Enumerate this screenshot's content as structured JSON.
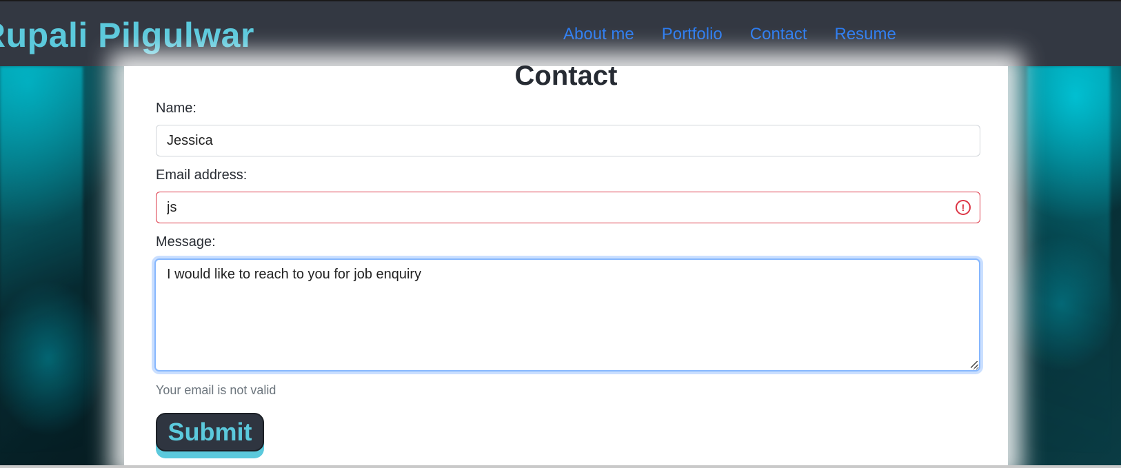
{
  "header": {
    "brand": "Rupali Pilgulwar",
    "nav": [
      {
        "label": "About me"
      },
      {
        "label": "Portfolio"
      },
      {
        "label": "Contact"
      },
      {
        "label": "Resume"
      }
    ]
  },
  "contact": {
    "title": "Contact",
    "name_label": "Name:",
    "name_value": "Jessica",
    "email_label": "Email address:",
    "email_value": "js",
    "message_label": "Message:",
    "message_value": "I would like to reach to you for job enquiry",
    "error_text": "Your email is not valid",
    "submit_label": "Submit"
  },
  "icons": {
    "email_invalid": "exclamation-circle-icon"
  },
  "colors": {
    "header_bg": "#333842",
    "brand": "#5bc9dc",
    "nav_link": "#2b7bf0",
    "invalid": "#dc3545",
    "focus": "#86b7fe",
    "submit_bg": "#2f3540"
  }
}
